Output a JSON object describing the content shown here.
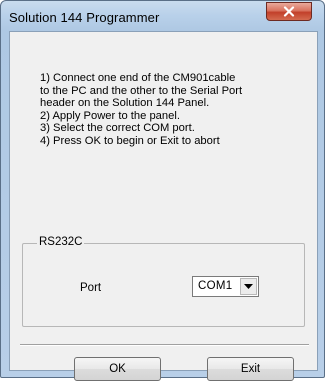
{
  "window": {
    "title": "Solution 144 Programmer"
  },
  "instructions": [
    "1) Connect one end of the CM901cable",
    "to the PC and the other to the Serial Port",
    "header on the Solution 144 Panel.",
    "2) Apply Power to the panel.",
    "3) Select the correct COM port.",
    "4) Press OK to begin or Exit to abort"
  ],
  "rs232c_group": {
    "title": "RS232C",
    "port_label": "Port",
    "port_value": "COM1"
  },
  "buttons": {
    "ok_label": "OK",
    "exit_label": "Exit"
  },
  "icons": {
    "close": "close-x-icon",
    "dropdown": "chevron-down-icon"
  }
}
